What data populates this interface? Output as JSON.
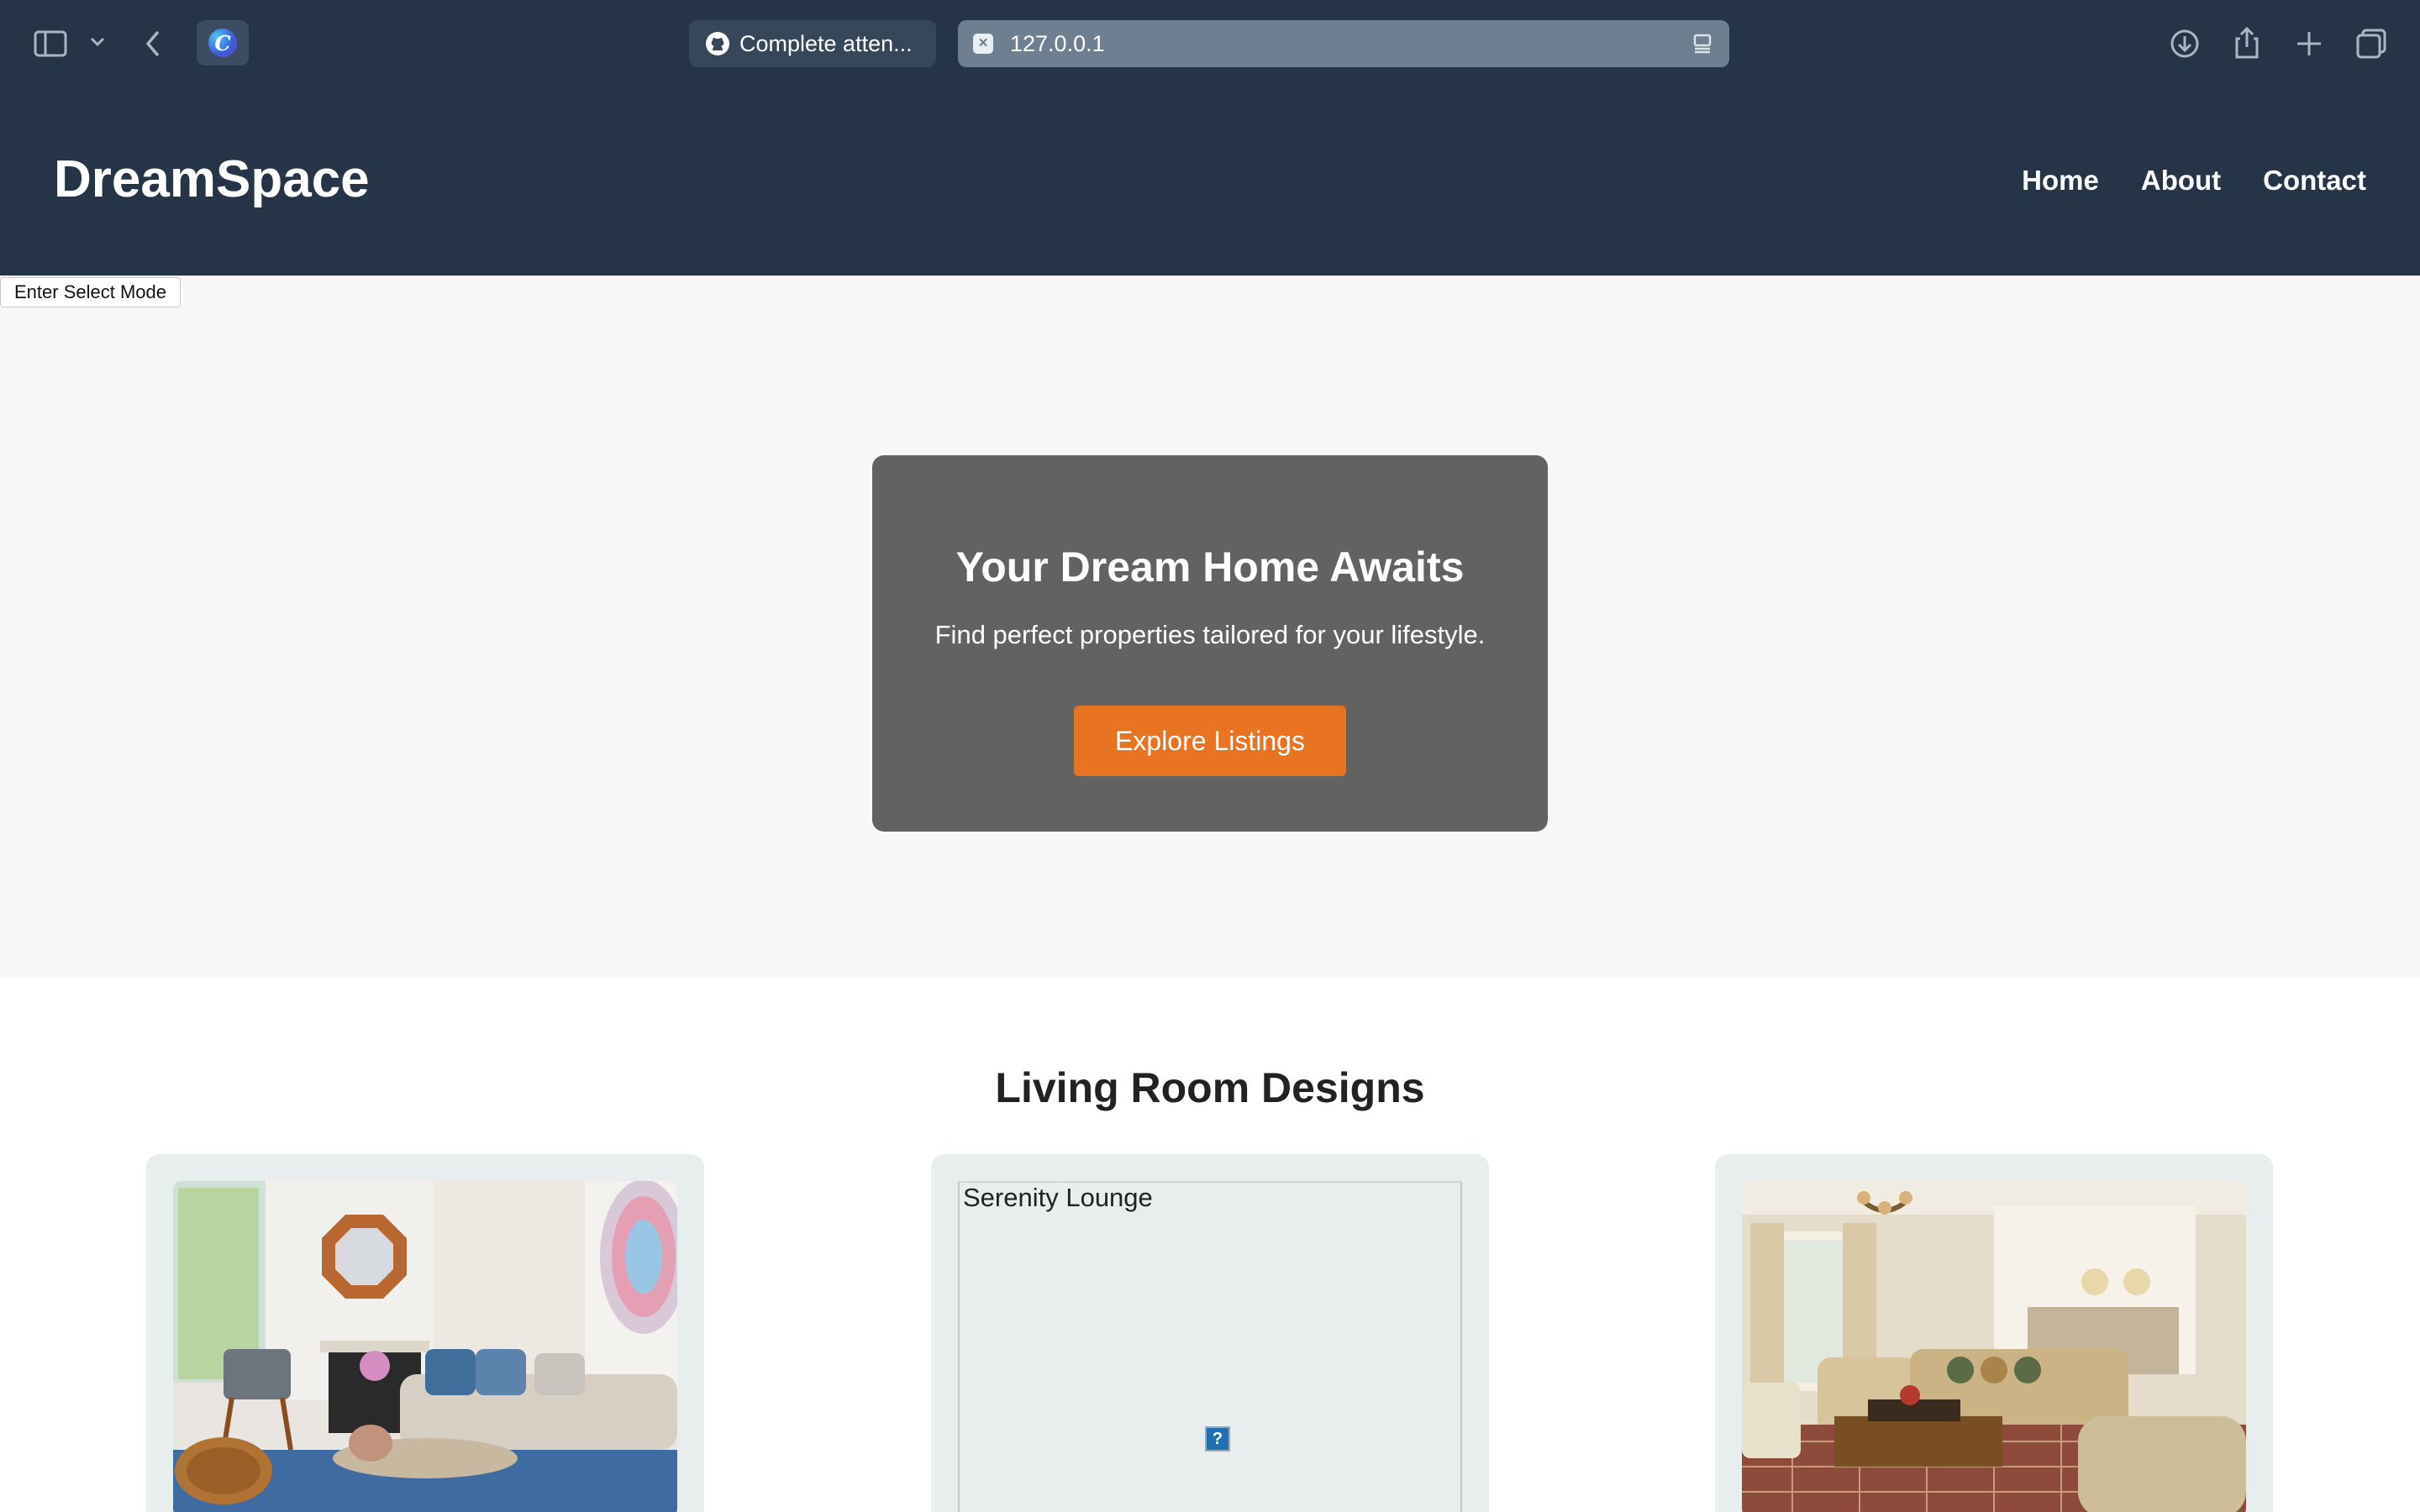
{
  "browser": {
    "tabs": [
      {
        "label": "Complete atten...",
        "icon": "github-icon"
      },
      {
        "label": "127.0.0.1",
        "icon": "close-favicon-icon"
      }
    ],
    "extension_letter": "C"
  },
  "site": {
    "brand": "DreamSpace",
    "nav": [
      "Home",
      "About",
      "Contact"
    ],
    "select_mode_label": "Enter Select Mode"
  },
  "hero": {
    "title": "Your Dream Home Awaits",
    "subtitle": "Find perfect properties tailored for your lifestyle.",
    "cta": "Explore Listings"
  },
  "designs": {
    "title": "Living Room Designs",
    "cards": [
      {
        "image": "living-room-photo"
      },
      {
        "alt": "Serenity Lounge",
        "broken_icon": "?"
      },
      {
        "image": "traditional-living-room-photo"
      }
    ]
  },
  "colors": {
    "header_bg": "#253447",
    "accent": "#e87421",
    "hero_box": "#626262"
  }
}
